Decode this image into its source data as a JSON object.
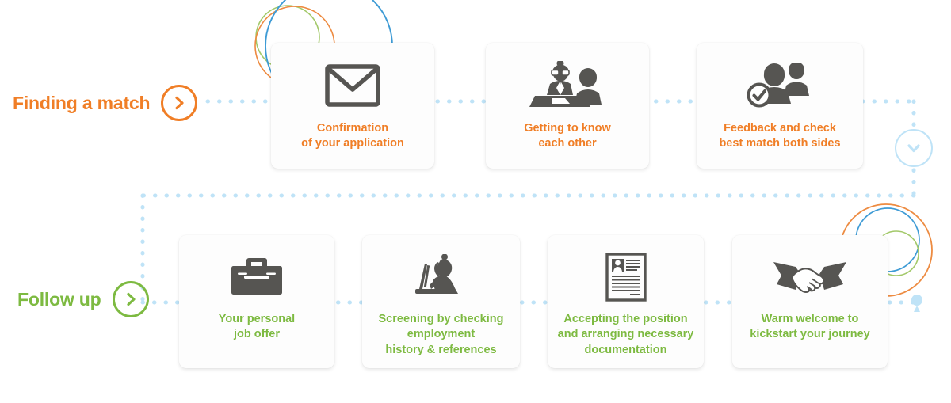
{
  "colors": {
    "orange": "#F07E26",
    "green": "#7DBA41",
    "icon_gray": "#565552",
    "dot_blue": "#BFE3F7",
    "decor_blue": "#3E9BD5",
    "decor_orange": "#ED8B41",
    "decor_green": "#A3C96A",
    "card_bg": "#FDFDFD"
  },
  "stages": [
    {
      "id": "finding",
      "label": "Finding a match",
      "accent": "#F07E26",
      "arrow_icon": "chevron-right-icon"
    },
    {
      "id": "followup",
      "label": "Follow up",
      "accent": "#7DBA41",
      "arrow_icon": "chevron-right-icon"
    }
  ],
  "top_row": {
    "cards": [
      {
        "id": "confirmation",
        "icon": "envelope-icon",
        "lines": [
          "Confirmation",
          "of your application"
        ]
      },
      {
        "id": "getting-to-know",
        "icon": "interview-two-people-icon",
        "lines": [
          "Getting to know",
          "each other"
        ]
      },
      {
        "id": "feedback",
        "icon": "people-check-icon",
        "lines": [
          "Feedback and check",
          "best match both sides"
        ]
      }
    ]
  },
  "bottom_row": {
    "cards": [
      {
        "id": "job-offer",
        "icon": "briefcase-icon",
        "lines": [
          "Your personal",
          "job offer"
        ]
      },
      {
        "id": "screening",
        "icon": "person-laptop-icon",
        "lines": [
          "Screening by checking",
          "employment",
          "history & references"
        ]
      },
      {
        "id": "accepting",
        "icon": "resume-document-icon",
        "lines": [
          "Accepting the position",
          "and arranging necessary",
          "documentation"
        ]
      },
      {
        "id": "welcome",
        "icon": "handshake-icon",
        "lines": [
          "Warm welcome to",
          "kickstart your journey"
        ]
      }
    ]
  },
  "flow": {
    "down_arrow_icon": "chevron-down-icon",
    "connector_style": "dotted"
  }
}
